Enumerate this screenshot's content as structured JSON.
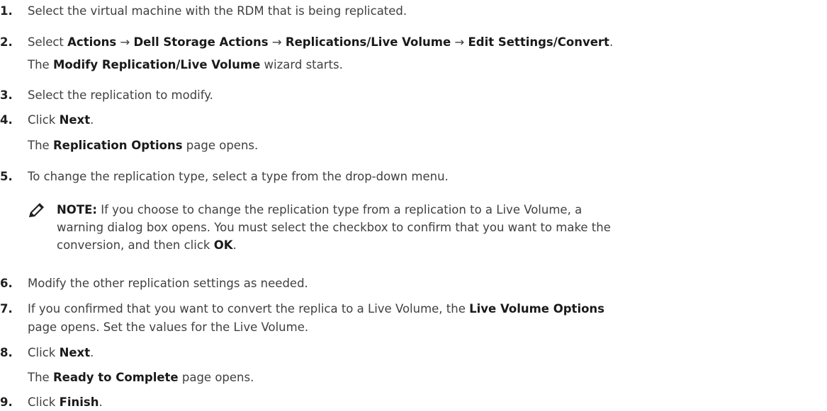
{
  "steps": [
    {
      "num": "1.",
      "text": "Select the virtual machine with the RDM that is being replicated."
    },
    {
      "num": "2.",
      "prefix": "Select ",
      "b1": "Actions",
      "arrow1": " → ",
      "b2": "Dell Storage Actions",
      "arrow2": " → ",
      "b3": "Replications/Live Volume",
      "arrow3": " → ",
      "b4": "Edit Settings/Convert",
      "suffix": "."
    },
    {
      "sub_b": "Modify Replication/Live Volume",
      "sub_suffix": " wizard starts."
    },
    {
      "num": "3.",
      "text": "Select the replication to modify."
    },
    {
      "num": "4.",
      "prefix": "Click ",
      "bold": "Next",
      "suffix": "."
    },
    {
      "sub_prefix": "The ",
      "sub_b": "Replication Options",
      "sub_suffix": " page opens."
    },
    {
      "num": "5.",
      "text": "To change the replication type, select a type from the drop-down menu."
    },
    {
      "num": "6.",
      "text": "Modify the other replication settings as needed."
    },
    {
      "num": "7.",
      "prefix": "If you confirmed that you want to convert the replica to a Live Volume, the ",
      "bold": "Live Volume Options",
      "line2": "page opens. Set the values for the Live Volume."
    },
    {
      "num": "8.",
      "prefix": "Click ",
      "bold": "Next",
      "suffix": "."
    },
    {
      "sub_prefix": "The ",
      "sub_b": "Ready to Complete",
      "sub_suffix": " page opens."
    },
    {
      "num": "9.",
      "prefix": "Click ",
      "bold": "Finish",
      "suffix": "."
    }
  ],
  "note": {
    "label": "NOTE:",
    "line1": " If you choose to change the replication type from a replication to a Live Volume, a",
    "line2": "warning dialog box opens. You must select the checkbox to confirm that you want to make the",
    "line3_prefix": "conversion, and then click ",
    "line3_bold": "OK",
    "line3_suffix": "."
  },
  "icons": {
    "note_icon": "pencil-note-icon"
  }
}
